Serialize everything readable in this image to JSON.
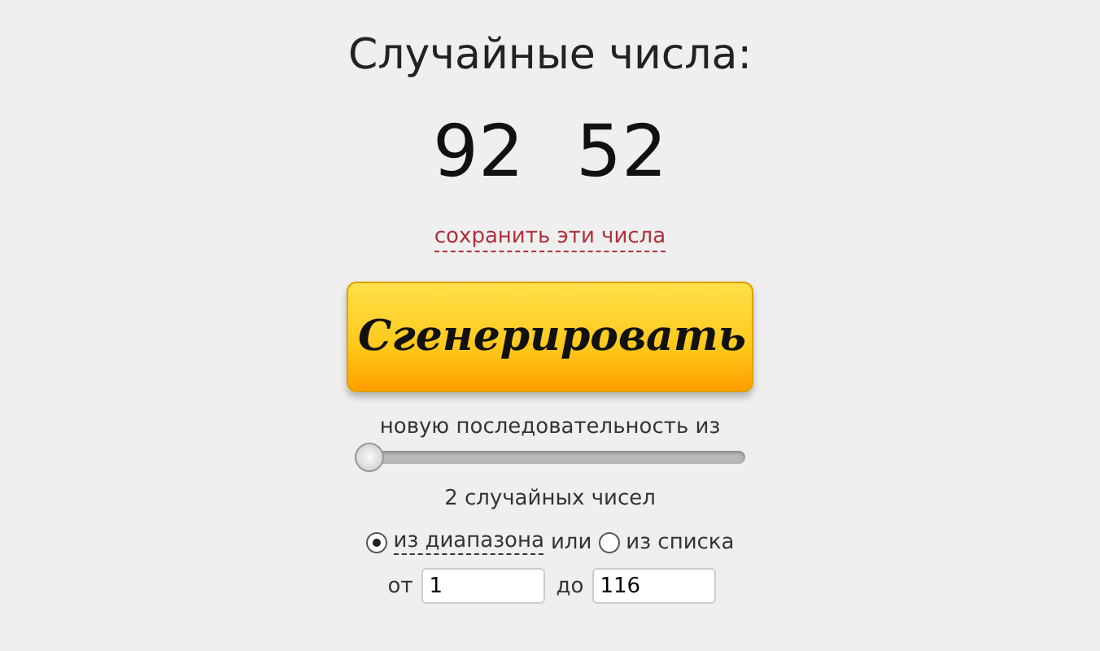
{
  "title": "Случайные числа:",
  "numbers": [
    "92",
    "52"
  ],
  "save_link": "сохранить эти числа",
  "generate_button": "Сгенерировать",
  "sequence_label": "новую последовательность из",
  "slider": {
    "level": 0
  },
  "count_label": "2 случайных чисел",
  "source_options": [
    {
      "label": "из диапазона",
      "selected": true
    },
    {
      "label": "из списка",
      "selected": false
    }
  ],
  "source_separator": "или",
  "range": {
    "from_label": "от",
    "from_value": "1",
    "to_label": "до",
    "to_value": "116"
  }
}
